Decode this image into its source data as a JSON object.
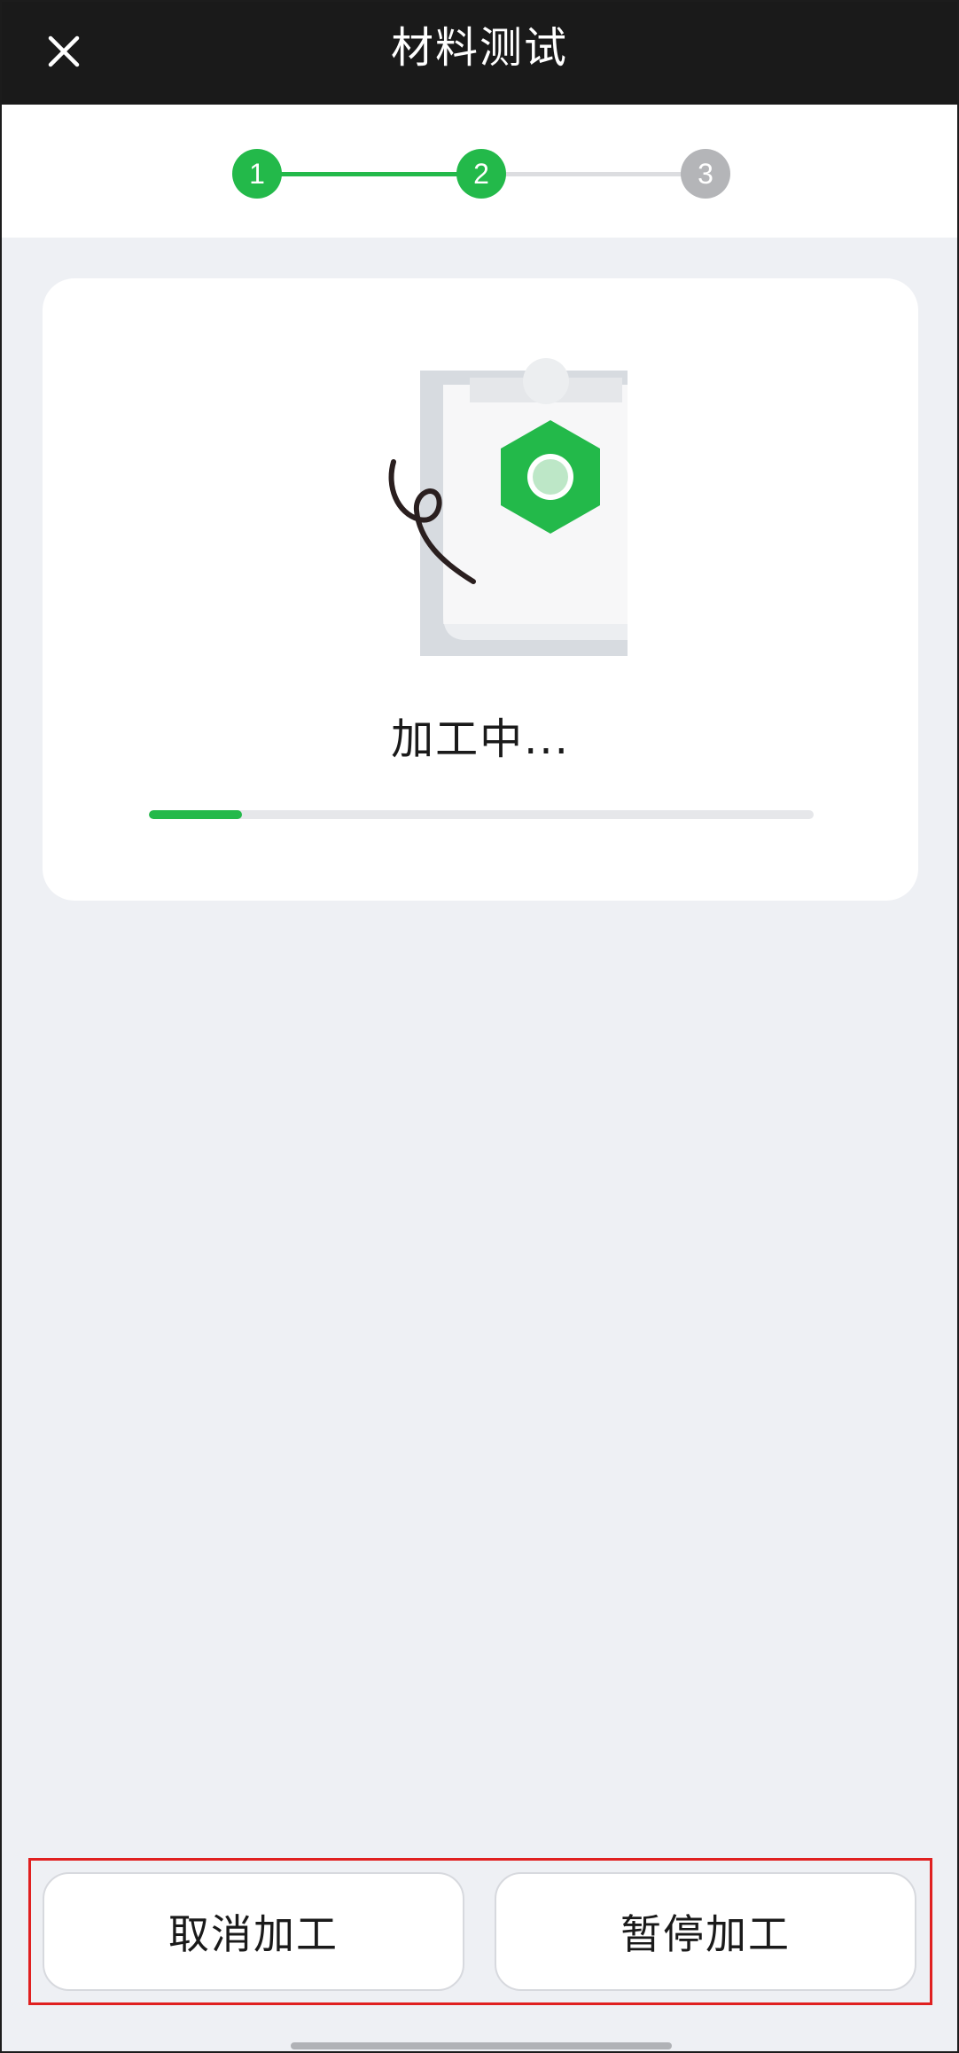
{
  "header": {
    "title": "材料测试",
    "close_icon": "close-icon"
  },
  "stepper": {
    "steps": [
      {
        "label": "1",
        "state": "done"
      },
      {
        "label": "2",
        "state": "active"
      },
      {
        "label": "3",
        "state": "pending"
      }
    ],
    "colors": {
      "done": "#23b94a",
      "pending": "#b4b5b8",
      "line_pending": "#dcdde0"
    }
  },
  "card": {
    "illustration_icon": "clipboard-hexagon-illustration",
    "status_text": "加工中...",
    "progress_fraction": 0.14
  },
  "actions": {
    "cancel_label": "取消加工",
    "pause_label": "暂停加工"
  },
  "colors": {
    "accent": "#23b94a",
    "header_bg": "#1a1a1a",
    "page_bg": "#eef0f4",
    "highlight_border": "#e02020"
  }
}
